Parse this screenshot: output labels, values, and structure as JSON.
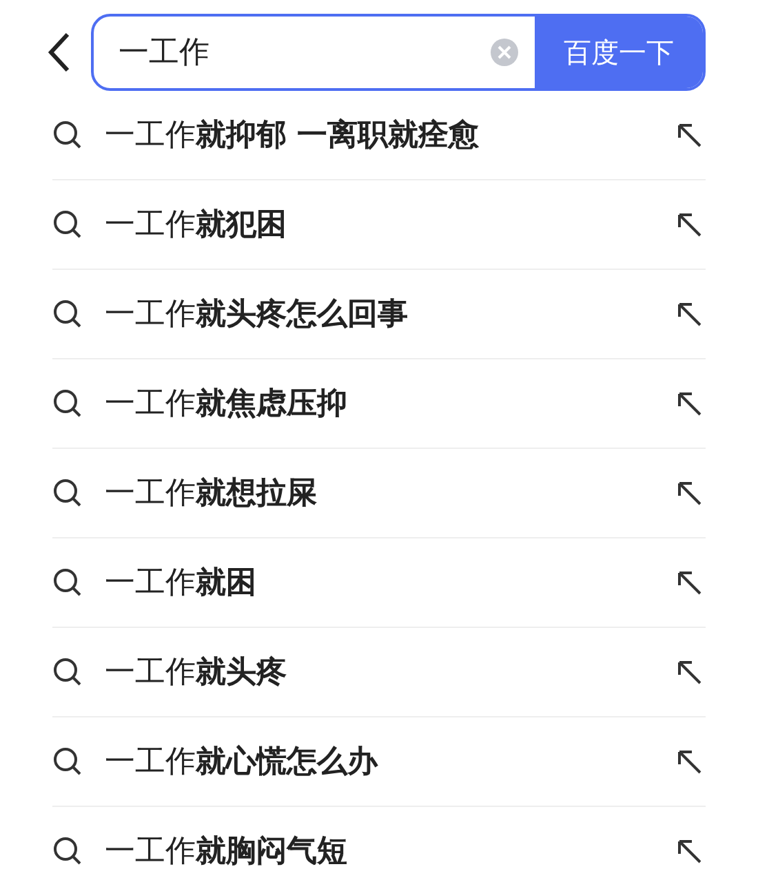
{
  "search": {
    "value": "一工作",
    "button": "百度一下"
  },
  "suggestions": [
    {
      "text": "一工作**就抑郁 一离职就痊愈**"
    },
    {
      "text": "一工作**就犯困**"
    },
    {
      "text": "一工作**就头疼怎么回事**"
    },
    {
      "text": "一工作**就焦虑压抑**"
    },
    {
      "text": "一工作**就想拉屎**"
    },
    {
      "text": "一工作**就困**"
    },
    {
      "text": "一工作**就头疼**"
    },
    {
      "text": "一工作**就心慌怎么办**"
    },
    {
      "text": "一工作**就胸闷气短**"
    }
  ]
}
